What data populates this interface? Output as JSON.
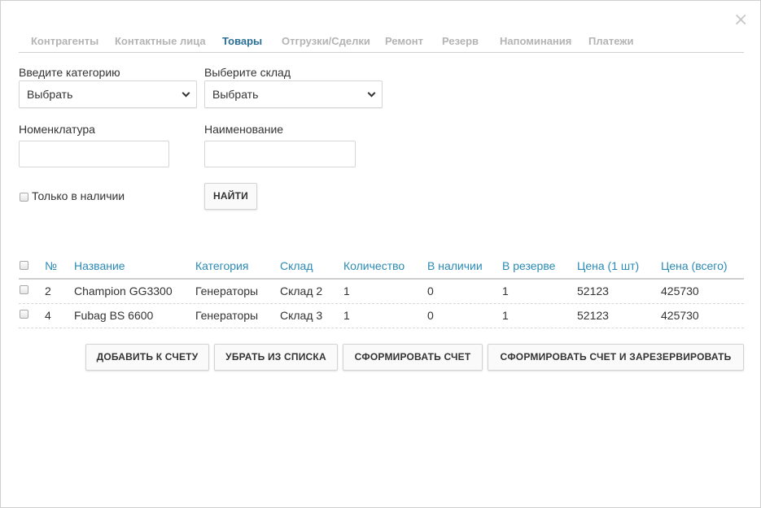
{
  "dialog": {
    "close_glyph": "×"
  },
  "tabs": [
    {
      "label": "Контрагенты",
      "active": false
    },
    {
      "label": "Контактные лица",
      "active": false
    },
    {
      "label": "Товары",
      "active": true
    },
    {
      "label": "Отгрузки/Сделки",
      "active": false
    },
    {
      "label": "Ремонт",
      "active": false
    },
    {
      "label": "Резерв",
      "active": false
    },
    {
      "label": "Напоминания",
      "active": false
    },
    {
      "label": "Платежи",
      "active": false
    }
  ],
  "filters": {
    "category_label": "Введите категорию",
    "category_value": "Выбрать",
    "warehouse_label": "Выберите склад",
    "warehouse_value": "Выбрать",
    "nomenclature_label": "Номенклатура",
    "nomenclature_value": "",
    "name_label": "Наименование",
    "name_value": "",
    "in_stock_label": "Только в наличии",
    "in_stock_checked": false,
    "search_button": "НАЙТИ"
  },
  "table": {
    "headers": [
      "№",
      "Название",
      "Категория",
      "Склад",
      "Количество",
      "В наличии",
      "В резерве",
      "Цена (1 шт)",
      "Цена (всего)"
    ],
    "rows": [
      [
        "2",
        "Champion GG3300",
        "Генераторы",
        "Склад 2",
        "1",
        "0",
        "1",
        "52123",
        "425730"
      ],
      [
        "4",
        "Fubag BS 6600",
        "Генераторы",
        "Склад 3",
        "1",
        "0",
        "1",
        "52123",
        "425730"
      ]
    ]
  },
  "actions": {
    "add_to_invoice": "ДОБАВИТЬ К СЧЕТУ",
    "remove_from_list": "УБРАТЬ ИЗ СПИСКА",
    "create_invoice": "СФОРМИРОВАТЬ СЧЕТ",
    "create_invoice_and_reserve": "СФОРМИРОВАТЬ СЧЕТ И ЗАРЕЗЕРВИРОВАТЬ"
  },
  "colors": {
    "accent": "#2a8ab5",
    "active_tab": "#2a6f97",
    "inactive_tab": "#b4b4b4"
  }
}
